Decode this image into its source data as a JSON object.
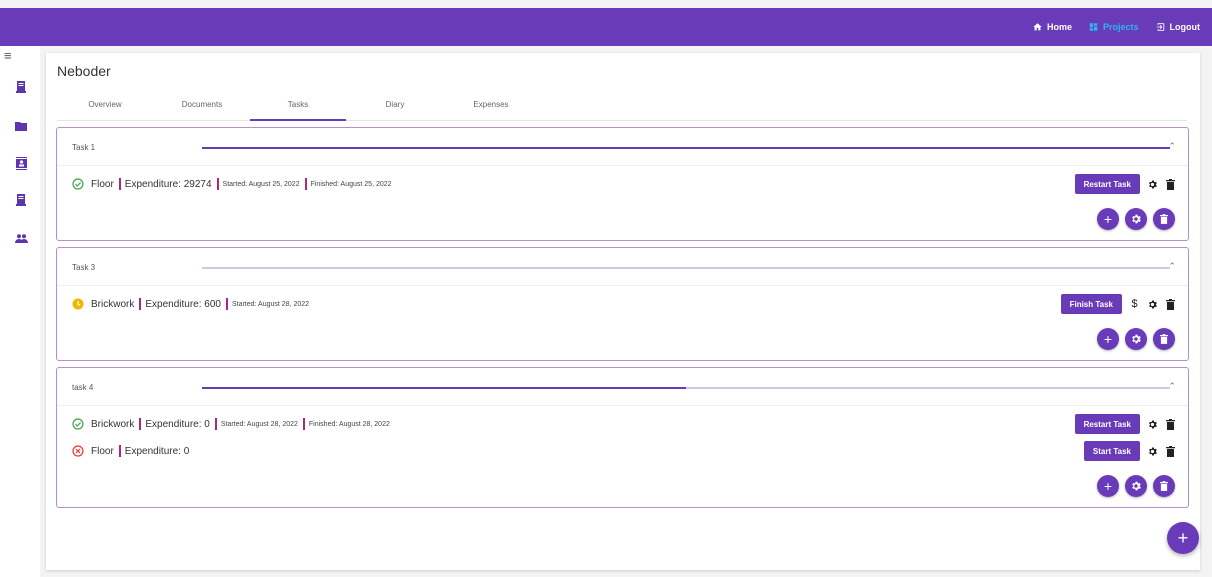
{
  "nav": {
    "home_label": "Home",
    "projects_label": "Projects",
    "logout_label": "Logout"
  },
  "sidebar": {
    "items": [
      {
        "icon": "book-icon"
      },
      {
        "icon": "folder-icon"
      },
      {
        "icon": "contacts-icon"
      },
      {
        "icon": "book-icon"
      },
      {
        "icon": "people-icon"
      }
    ]
  },
  "project": {
    "title": "Neboder",
    "tabs": [
      "Overview",
      "Documents",
      "Tasks",
      "Diary",
      "Expenses"
    ],
    "active_tab": "Tasks"
  },
  "tasks": [
    {
      "name": "Task 1",
      "progress": 1.0,
      "items": [
        {
          "status": "done",
          "name": "Floor",
          "expenditure": "Expenditure: 29274",
          "started": "Started: August 25, 2022",
          "finished": "Finished: August 25, 2022",
          "action": "Restart Task"
        }
      ]
    },
    {
      "name": "Task 3",
      "progress": 0.0,
      "items": [
        {
          "status": "in-progress",
          "name": "Brickwork",
          "expenditure": "Expenditure: 600",
          "started": "Started: August 28, 2022",
          "action": "Finish Task",
          "currency": "$"
        }
      ]
    },
    {
      "name": "task 4",
      "progress": 0.5,
      "items": [
        {
          "status": "done",
          "name": "Brickwork",
          "expenditure": "Expenditure: 0",
          "started": "Started: August 28, 2022",
          "finished": "Finished: August 28, 2022",
          "action": "Restart Task"
        },
        {
          "status": "not-started",
          "name": "Floor",
          "expenditure": "Expenditure: 0",
          "action": "Start Task"
        }
      ]
    }
  ],
  "colors": {
    "primary": "#6a3bb8",
    "accent_active": "#29b6f6",
    "separator": "#b0277a",
    "done": "#43a047",
    "in_progress": "#f2b600",
    "error": "#e53935"
  }
}
